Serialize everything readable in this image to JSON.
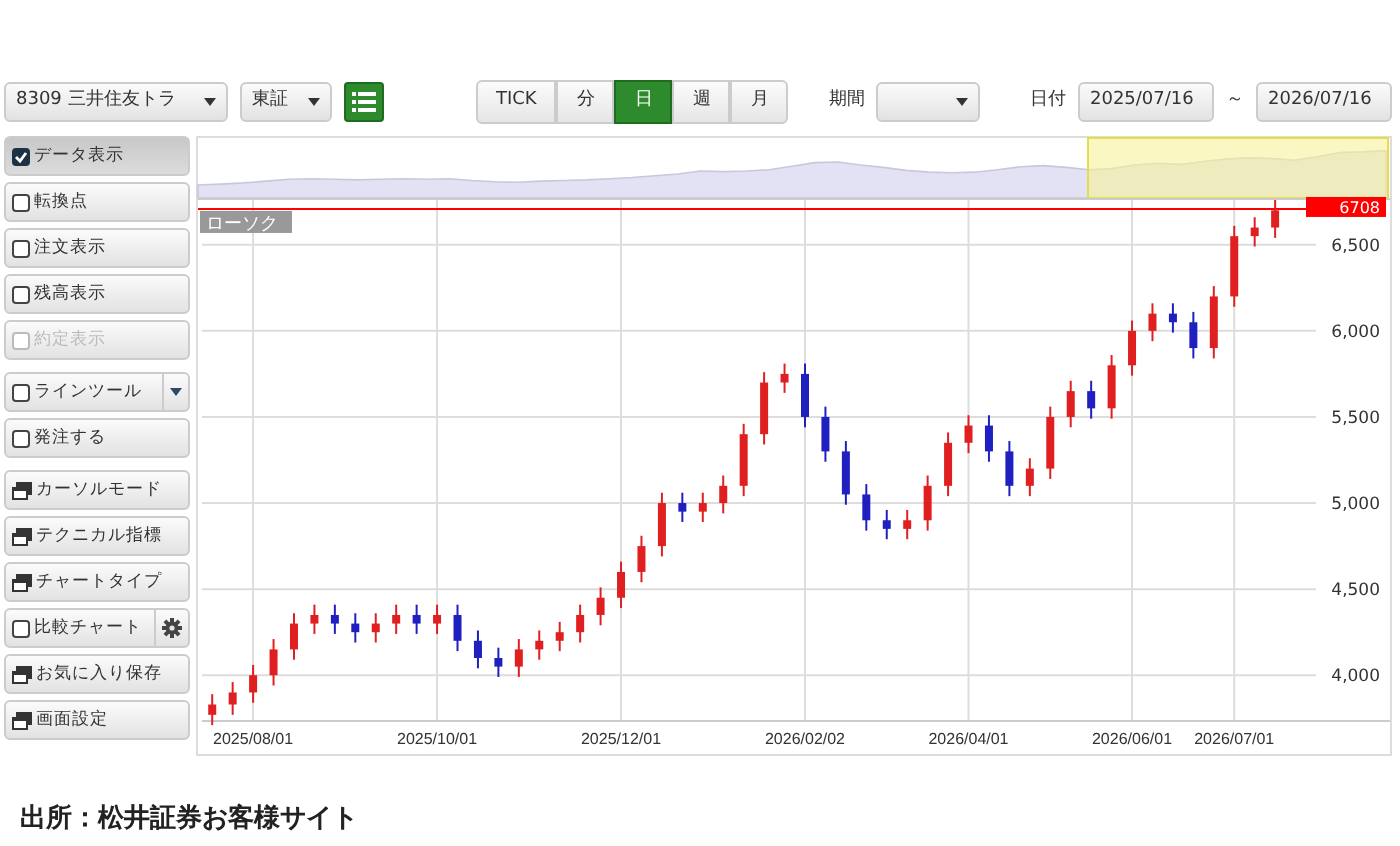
{
  "toolbar": {
    "symbol_select": "8309 三井住友トラ",
    "market_select": "東証",
    "period_tabs": [
      {
        "label": "TICK",
        "selected": false
      },
      {
        "label": "分",
        "selected": false
      },
      {
        "label": "日",
        "selected": true
      },
      {
        "label": "週",
        "selected": false
      },
      {
        "label": "月",
        "selected": false
      }
    ],
    "range_label": "期間",
    "date_label": "日付",
    "date_from": "2025/07/16",
    "date_separator": "～",
    "date_to": "2026/07/16"
  },
  "sidebar": {
    "groups": [
      {
        "items": [
          {
            "kind": "checkbox",
            "label": "データ表示",
            "checked": true,
            "disabled": false
          },
          {
            "kind": "checkbox",
            "label": "転換点",
            "checked": false,
            "disabled": false
          },
          {
            "kind": "checkbox",
            "label": "注文表示",
            "checked": false,
            "disabled": false
          },
          {
            "kind": "checkbox",
            "label": "残高表示",
            "checked": false,
            "disabled": false
          },
          {
            "kind": "checkbox",
            "label": "約定表示",
            "checked": false,
            "disabled": true
          }
        ]
      },
      {
        "items": [
          {
            "kind": "checkbox-dropdown",
            "label": "ラインツール",
            "checked": false,
            "disabled": false
          },
          {
            "kind": "checkbox",
            "label": "発注する",
            "checked": false,
            "disabled": false
          }
        ]
      },
      {
        "items": [
          {
            "kind": "window",
            "label": "カーソルモード"
          },
          {
            "kind": "window",
            "label": "テクニカル指標"
          },
          {
            "kind": "window",
            "label": "チャートタイプ"
          },
          {
            "kind": "checkbox-gear",
            "label": "比較チャート",
            "checked": false,
            "disabled": false
          },
          {
            "kind": "window",
            "label": "お気に入り保存"
          },
          {
            "kind": "window",
            "label": "画面設定"
          }
        ]
      }
    ]
  },
  "chart": {
    "series_label": "ローソク",
    "chart_data": {
      "type": "candlestick",
      "categories": [
        null,
        null,
        "2025/08/01",
        null,
        null,
        null,
        null,
        null,
        null,
        null,
        null,
        "2025/10/01",
        null,
        null,
        null,
        null,
        null,
        null,
        null,
        null,
        "2025/12/01",
        null,
        null,
        null,
        null,
        null,
        null,
        null,
        null,
        "2026/02/02",
        null,
        null,
        null,
        null,
        null,
        null,
        null,
        "2026/04/01",
        null,
        null,
        null,
        null,
        null,
        null,
        null,
        "2026/06/01",
        null,
        null,
        null,
        null,
        "2026/07/01",
        null,
        null
      ],
      "ohlc": [
        [
          3770,
          3890,
          3710,
          3830
        ],
        [
          3830,
          3960,
          3770,
          3900
        ],
        [
          3900,
          4060,
          3840,
          4000
        ],
        [
          4000,
          4210,
          3940,
          4150
        ],
        [
          4150,
          4360,
          4090,
          4300
        ],
        [
          4300,
          4410,
          4240,
          4350
        ],
        [
          4350,
          4410,
          4240,
          4300
        ],
        [
          4300,
          4360,
          4190,
          4250
        ],
        [
          4250,
          4360,
          4190,
          4300
        ],
        [
          4300,
          4410,
          4240,
          4350
        ],
        [
          4350,
          4410,
          4240,
          4300
        ],
        [
          4300,
          4410,
          4240,
          4350
        ],
        [
          4350,
          4410,
          4140,
          4200
        ],
        [
          4200,
          4260,
          4040,
          4100
        ],
        [
          4100,
          4160,
          3990,
          4050
        ],
        [
          4050,
          4210,
          3990,
          4150
        ],
        [
          4150,
          4260,
          4090,
          4200
        ],
        [
          4200,
          4310,
          4140,
          4250
        ],
        [
          4250,
          4410,
          4190,
          4350
        ],
        [
          4350,
          4510,
          4290,
          4450
        ],
        [
          4450,
          4660,
          4390,
          4600
        ],
        [
          4600,
          4810,
          4540,
          4750
        ],
        [
          4750,
          5060,
          4690,
          5000
        ],
        [
          5000,
          5060,
          4890,
          4950
        ],
        [
          4950,
          5060,
          4890,
          5000
        ],
        [
          5000,
          5160,
          4940,
          5100
        ],
        [
          5100,
          5460,
          5040,
          5400
        ],
        [
          5400,
          5760,
          5340,
          5700
        ],
        [
          5700,
          5810,
          5640,
          5750
        ],
        [
          5750,
          5810,
          5440,
          5500
        ],
        [
          5500,
          5560,
          5240,
          5300
        ],
        [
          5300,
          5360,
          4990,
          5050
        ],
        [
          5050,
          5110,
          4840,
          4900
        ],
        [
          4900,
          4960,
          4790,
          4850
        ],
        [
          4850,
          4960,
          4790,
          4900
        ],
        [
          4900,
          5160,
          4840,
          5100
        ],
        [
          5100,
          5410,
          5040,
          5350
        ],
        [
          5350,
          5510,
          5290,
          5450
        ],
        [
          5450,
          5510,
          5240,
          5300
        ],
        [
          5300,
          5360,
          5040,
          5100
        ],
        [
          5100,
          5260,
          5040,
          5200
        ],
        [
          5200,
          5560,
          5140,
          5500
        ],
        [
          5500,
          5710,
          5440,
          5650
        ],
        [
          5650,
          5710,
          5490,
          5550
        ],
        [
          5550,
          5860,
          5490,
          5800
        ],
        [
          5800,
          6060,
          5740,
          6000
        ],
        [
          6000,
          6160,
          5940,
          6100
        ],
        [
          6100,
          6160,
          5990,
          6050
        ],
        [
          6050,
          6110,
          5840,
          5900
        ],
        [
          5900,
          6260,
          5840,
          6200
        ],
        [
          6200,
          6610,
          6140,
          6550
        ],
        [
          6550,
          6660,
          6490,
          6600
        ],
        [
          6600,
          6760,
          6540,
          6700
        ]
      ],
      "ylim": [
        3740,
        6760
      ],
      "yticks": [
        {
          "value": 4000,
          "label": "4,000"
        },
        {
          "value": 4500,
          "label": "4,500"
        },
        {
          "value": 5000,
          "label": "5,000"
        },
        {
          "value": 5500,
          "label": "5,500"
        },
        {
          "value": 6000,
          "label": "6,000"
        },
        {
          "value": 6500,
          "label": "6,500"
        }
      ],
      "grid": true,
      "ref_lines": [
        {
          "axis": "y",
          "value": 6708,
          "label": "6708"
        }
      ]
    }
  },
  "caption": "出所：松井証券お客様サイト"
}
